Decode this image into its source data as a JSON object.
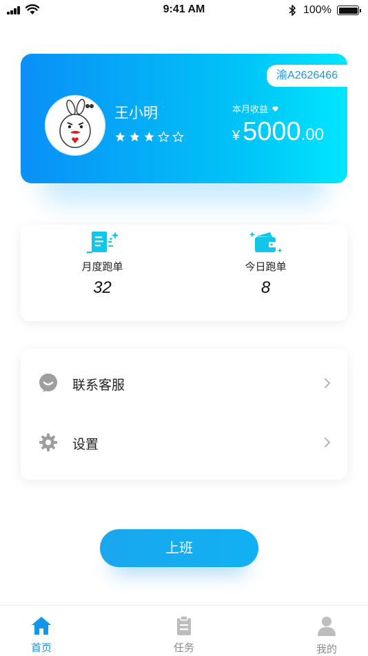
{
  "status_bar": {
    "time": "9:41 AM",
    "battery": "100%",
    "icons": [
      "signal-icon",
      "wifi-icon",
      "bluetooth-icon",
      "battery-icon"
    ]
  },
  "profile": {
    "plate": "渝A2626466",
    "name": "王小明",
    "rating": 3,
    "rating_max": 5,
    "earnings_label": "本月收益",
    "earnings_currency": "¥",
    "earnings_integer": "5000",
    "earnings_decimal": ".00",
    "avatar_icon": "cartoon-rabbit-avatar"
  },
  "stats": [
    {
      "label": "月度跑单",
      "value": "32",
      "icon": "document-list-icon"
    },
    {
      "label": "今日跑单",
      "value": "8",
      "icon": "wallet-icon"
    }
  ],
  "menu": [
    {
      "label": "联系客服",
      "icon": "customer-service-icon"
    },
    {
      "label": "设置",
      "icon": "gear-icon"
    }
  ],
  "action_button": "上班",
  "tabs": [
    {
      "label": "首页",
      "icon": "home-icon",
      "active": true
    },
    {
      "label": "任务",
      "icon": "clipboard-icon",
      "active": false
    },
    {
      "label": "我的",
      "icon": "person-icon",
      "active": false
    }
  ],
  "colors": {
    "accent": "#1296e8",
    "gradient_start": "#0a8ff7",
    "gradient_end": "#00e6ff",
    "icon_cyan": "#11c6e8",
    "menu_icon_gray": "#9e9e9e",
    "tab_inactive": "#bdbdbd"
  }
}
